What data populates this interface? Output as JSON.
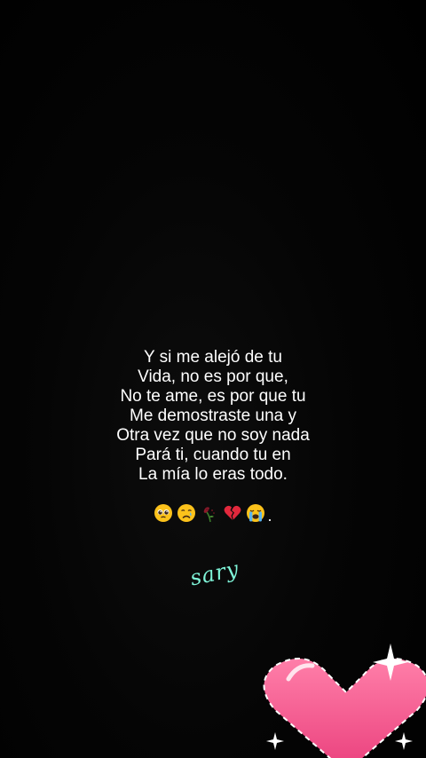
{
  "poem": {
    "lines": [
      "Y si me alejó de tu",
      "Vida, no es por que,",
      "No te ame, es por que tu",
      "Me demostraste una y",
      "Otra vez que no soy nada",
      "Pará ti, cuando tu en",
      "La mía lo eras todo."
    ]
  },
  "emojis": {
    "items": [
      "pleading-face-icon",
      "sad-face-icon",
      "wilted-rose-icon",
      "broken-heart-icon",
      "crying-face-icon"
    ],
    "trailing": "."
  },
  "signature": {
    "text": "sary"
  },
  "colors": {
    "background": "#000000",
    "text": "#ffffff",
    "signature": "#7ff5d9",
    "heart": "#f0528a"
  }
}
